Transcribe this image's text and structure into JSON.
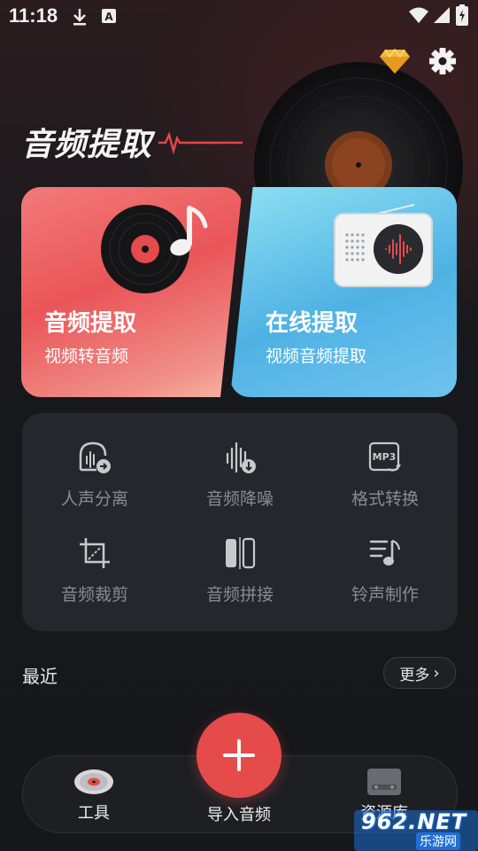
{
  "status_bar": {
    "time": "11:18"
  },
  "header": {
    "title": "音频提取",
    "icons": [
      "diamond-icon",
      "settings-icon"
    ]
  },
  "cards": [
    {
      "title": "音频提取",
      "subtitle": "视频转音频"
    },
    {
      "title": "在线提取",
      "subtitle": "视频音频提取"
    }
  ],
  "tools": [
    {
      "label": "人声分离",
      "icon": "vocal-separation-icon"
    },
    {
      "label": "音频降噪",
      "icon": "noise-reduction-icon"
    },
    {
      "label": "格式转换",
      "icon": "format-convert-icon"
    },
    {
      "label": "音频裁剪",
      "icon": "crop-icon"
    },
    {
      "label": "音频拼接",
      "icon": "merge-icon"
    },
    {
      "label": "铃声制作",
      "icon": "ringtone-icon"
    }
  ],
  "recent": {
    "label": "最近",
    "more_label": "更多"
  },
  "bottom_nav": {
    "tools_label": "工具",
    "import_label": "导入音频",
    "library_label": "资源库"
  },
  "watermark": {
    "brand": "962.NET",
    "sub": "乐游网"
  },
  "colors": {
    "accent_red": "#e64b4c",
    "card_red": "#ea5558",
    "card_blue": "#4fb2e4",
    "panel": "#26272c"
  }
}
